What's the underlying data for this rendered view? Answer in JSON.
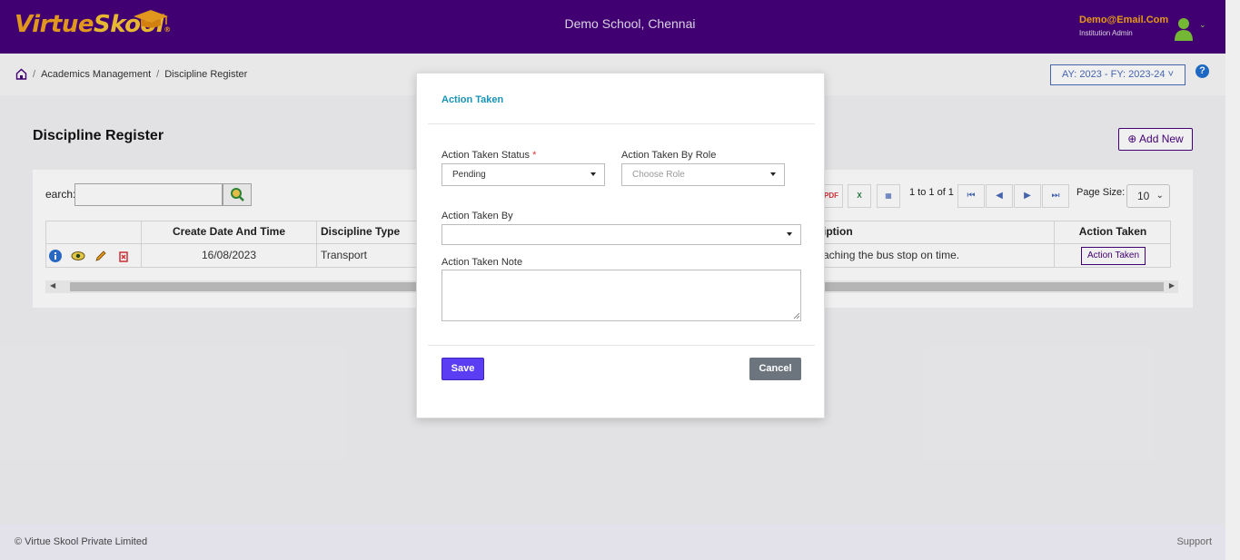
{
  "header": {
    "logo_part1": "Virtue",
    "logo_part2": "Skool",
    "logo_reg": "®",
    "school_name": "Demo School, Chennai",
    "user_email": "Demo@Email.Com",
    "user_role": "Institution Admin"
  },
  "breadcrumb": {
    "items": [
      "Academics Management",
      "Discipline Register"
    ],
    "separator": "/"
  },
  "academic_year": "AY: 2023 - FY: 2023-24 ˅",
  "help_label": "?",
  "page": {
    "title": "Discipline Register",
    "add_new_label": "Add New"
  },
  "toolbar": {
    "search_label": "earch:",
    "search_value": "",
    "pager_text": "1 to 1 of 1",
    "page_size_label": "Page Size:",
    "page_size_value": "10"
  },
  "grid": {
    "columns": [
      "Create Date And Time",
      "Discipline Type",
      "iption",
      "Action Taken"
    ],
    "rows": [
      {
        "create_date": "16/08/2023",
        "discipline_type": "Transport",
        "description": "aching the bus stop on time.",
        "action_label": "Action Taken"
      }
    ]
  },
  "footer": {
    "copyright": "© Virtue Skool Private Limited",
    "support": "Support"
  },
  "modal": {
    "title": "Action Taken",
    "status_label": "Action Taken Status",
    "status_required": "*",
    "status_value": "Pending",
    "role_label": "Action Taken By Role",
    "role_placeholder": "Choose Role",
    "by_label": "Action Taken By",
    "by_value": "",
    "note_label": "Action Taken Note",
    "note_value": "",
    "save_label": "Save",
    "cancel_label": "Cancel"
  },
  "colors": {
    "header_bg": "#45007a",
    "accent_orange": "#f5a31a",
    "modal_title": "#1794b8",
    "save_button": "#5b3df3",
    "cancel_button": "#6c757d"
  }
}
